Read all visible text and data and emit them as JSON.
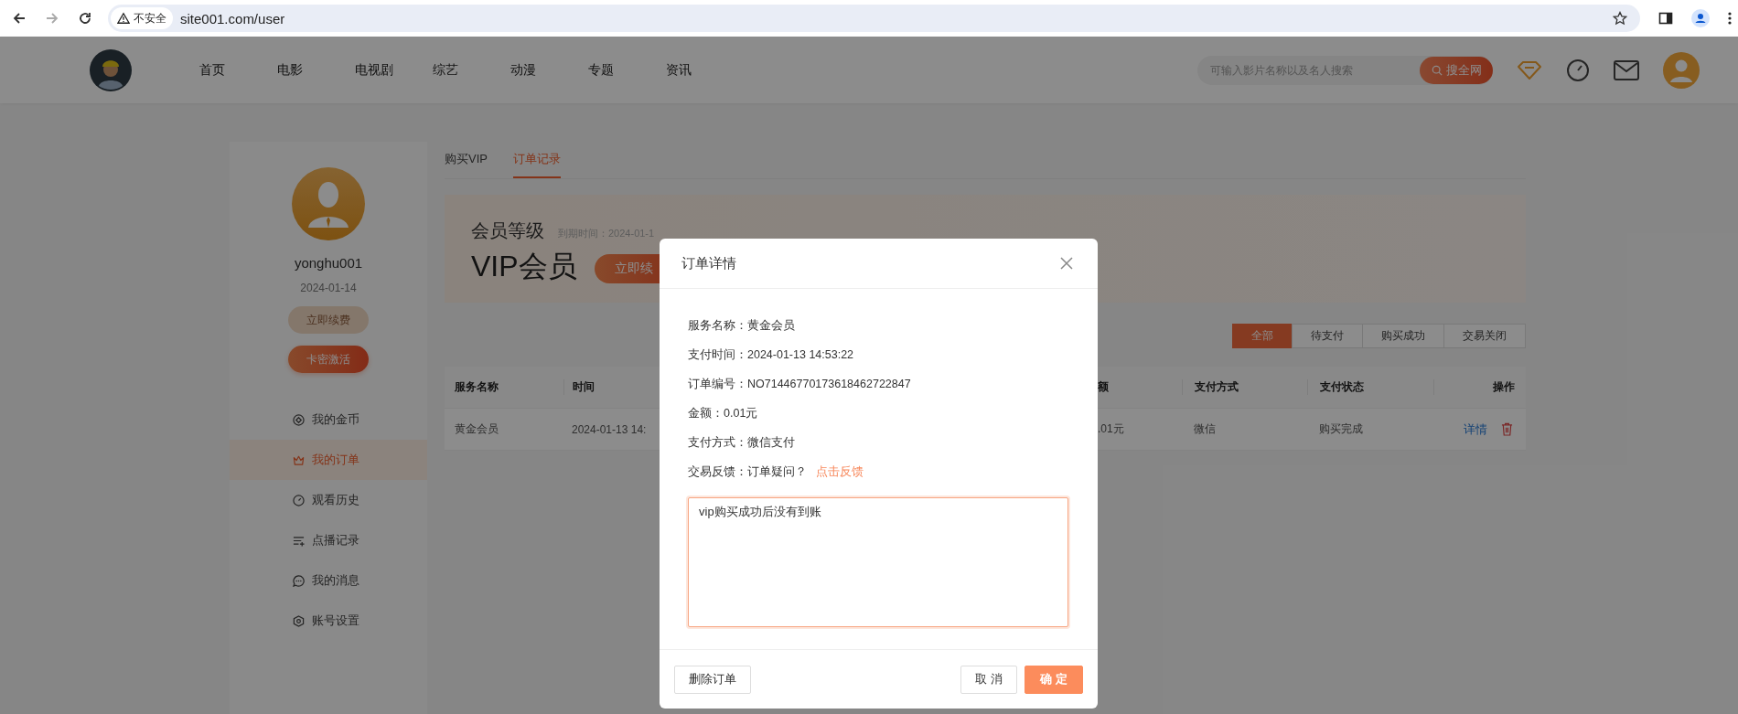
{
  "browser": {
    "security_label": "不安全",
    "url": "site001.com/user"
  },
  "header": {
    "nav": [
      {
        "label": "首页"
      },
      {
        "label": "电影"
      },
      {
        "label": "电视剧"
      },
      {
        "label": "综艺"
      },
      {
        "label": "动漫"
      },
      {
        "label": "专题"
      },
      {
        "label": "资讯"
      }
    ],
    "search": {
      "placeholder": "可输入影片名称以及名人搜索",
      "button": "搜全网"
    }
  },
  "profile": {
    "username": "yonghu001",
    "date": "2024-01-14",
    "buttons": [
      {
        "label": "立即续费",
        "disabled": true
      },
      {
        "label": "卡密激活",
        "disabled": false
      }
    ]
  },
  "menu": [
    {
      "label": "我的金币",
      "selected": false
    },
    {
      "label": "我的订单",
      "selected": true
    },
    {
      "label": "观看历史",
      "selected": false
    },
    {
      "label": "点播记录",
      "selected": false
    },
    {
      "label": "我的消息",
      "selected": false
    },
    {
      "label": "账号设置",
      "selected": false
    }
  ],
  "tabs": [
    {
      "label": "购买VIP",
      "selected": false
    },
    {
      "label": "订单记录",
      "selected": true
    }
  ],
  "membership": {
    "title": "会员等级",
    "expiry": "到期时间：2024-01-1",
    "grade": "VIP会员",
    "renew_button": "立即续"
  },
  "filters": [
    {
      "label": "全部",
      "selected": true
    },
    {
      "label": "待支付",
      "selected": false
    },
    {
      "label": "购买成功",
      "selected": false
    },
    {
      "label": "交易关闭",
      "selected": false
    }
  ],
  "table": {
    "columns": [
      "服务名称",
      "时间",
      "额",
      "支付方式",
      "支付状态",
      "操作"
    ],
    "rows": [
      {
        "cells": [
          "黄金会员",
          "2024-01-13 14:",
          ".01元",
          "微信",
          "购买完成"
        ],
        "action": "详情"
      }
    ]
  },
  "dialog": {
    "title": "订单详情",
    "fields": [
      {
        "label": "服务名称：",
        "value": "黄金会员"
      },
      {
        "label": "支付时间：",
        "value": "2024-01-13 14:53:22"
      },
      {
        "label": "订单编号：",
        "value": "NO71446770173618462722847"
      },
      {
        "label": "金额：",
        "value": "0.01元"
      },
      {
        "label": "支付方式：",
        "value": "微信支付"
      }
    ],
    "feedback": {
      "label": "交易反馈：",
      "value": "订单疑问？",
      "link": "点击反馈"
    },
    "feedback_text": "vip购买成功后没有到账",
    "delete_button": "删除订单",
    "cancel_button": "取 消",
    "confirm_button": "确 定"
  }
}
